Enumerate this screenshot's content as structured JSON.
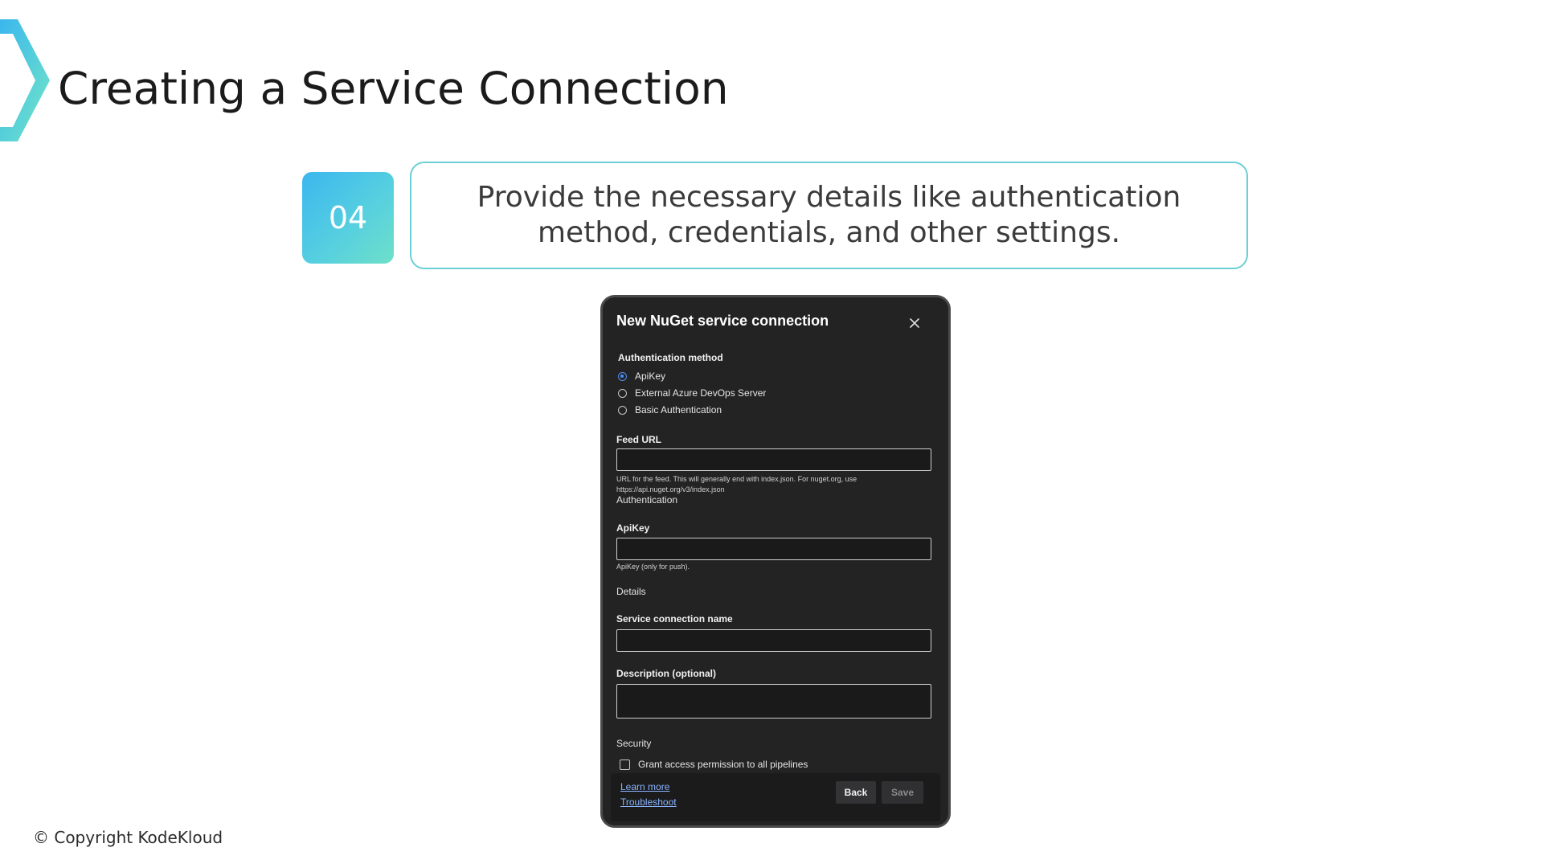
{
  "slide": {
    "title": "Creating a Service Connection",
    "step_number": "04",
    "step_text": "Provide the necessary details like authentication method, credentials, and other settings.",
    "copyright": "© Copyright KodeKloud",
    "accent_colors": [
      "#3bb7ee",
      "#6ee0c8"
    ]
  },
  "dialog": {
    "title": "New NuGet service connection",
    "close_icon": "close-icon",
    "auth_method_label": "Authentication method",
    "auth_options": [
      {
        "label": "ApiKey",
        "checked": true
      },
      {
        "label": "External Azure DevOps Server",
        "checked": false
      },
      {
        "label": "Basic Authentication",
        "checked": false
      }
    ],
    "feed_url_label": "Feed URL",
    "feed_url_value": "",
    "feed_url_hint_line1": "URL for the feed. This will generally end with index.json. For nuget.org, use",
    "feed_url_hint_line2": "https://api.nuget.org/v3/index.json",
    "authentication_section": "Authentication",
    "apikey_label": "ApiKey",
    "apikey_value": "",
    "apikey_hint": "ApiKey (only for push).",
    "details_section": "Details",
    "service_name_label": "Service connection name",
    "service_name_value": "",
    "description_label": "Description (optional)",
    "description_value": "",
    "security_section": "Security",
    "grant_access_label": "Grant access permission to all pipelines",
    "grant_access_checked": false,
    "learn_more": "Learn more",
    "troubleshoot": "Troubleshoot",
    "back_button": "Back",
    "save_button": "Save"
  }
}
